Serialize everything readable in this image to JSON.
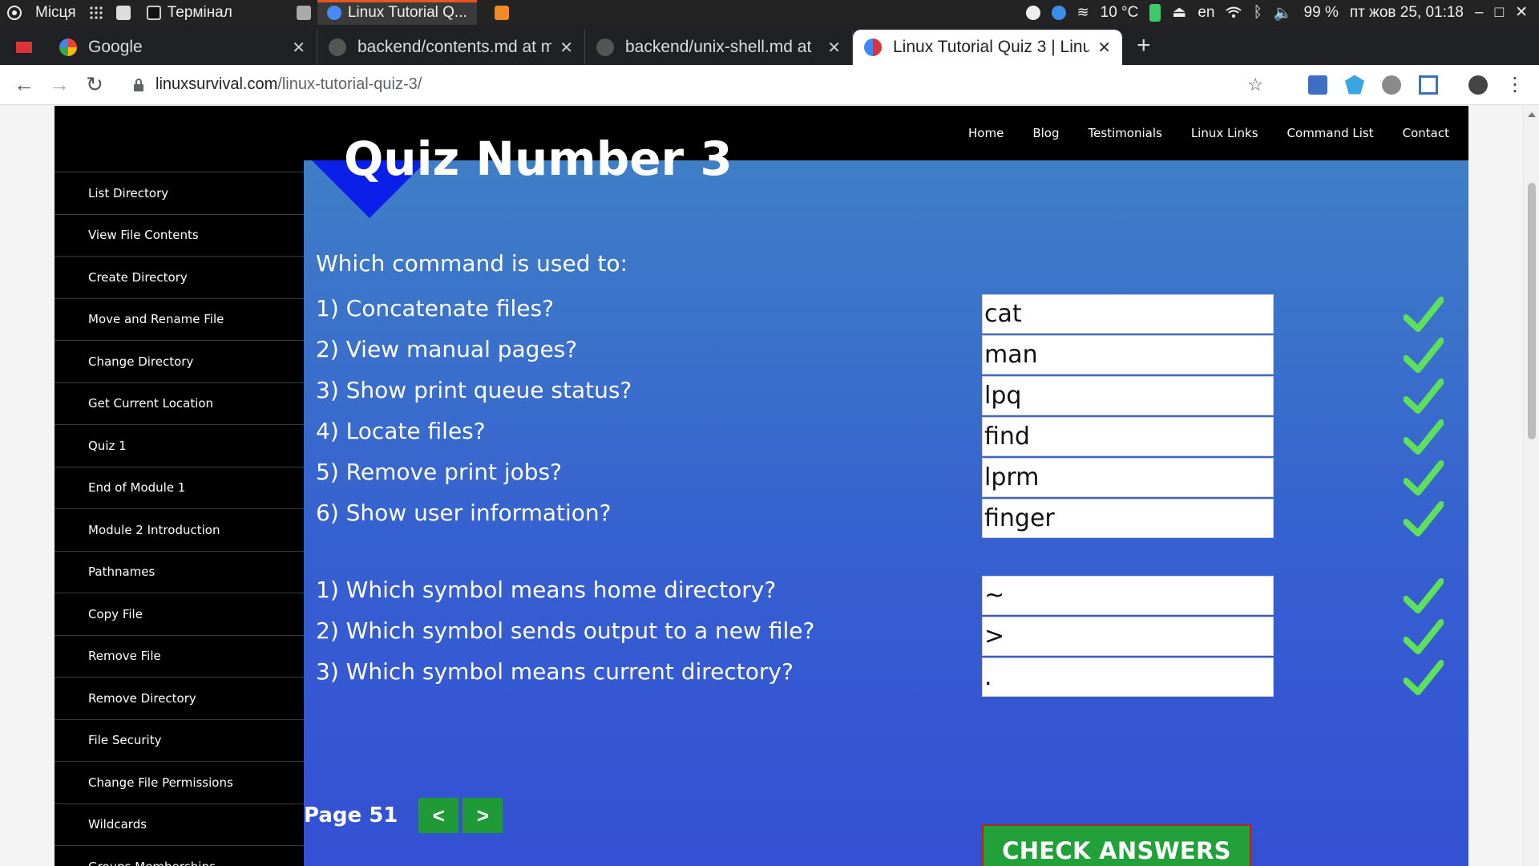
{
  "os_bar": {
    "places_label": "Місця",
    "terminal_label": "Термінал",
    "browser_task_label": "Linux Tutorial Q...",
    "temperature": "10 °C",
    "keyboard_layout": "en",
    "battery": "99 %",
    "datetime": "пт жов 25, 01:18"
  },
  "tabs": [
    {
      "title": "Google",
      "icon": "google-icon"
    },
    {
      "title": "backend/contents.md at m",
      "icon": "github-icon"
    },
    {
      "title": "backend/unix-shell.md at",
      "icon": "github-icon"
    },
    {
      "title": "Linux Tutorial Quiz 3 | Linu",
      "icon": "linuxsurvival-icon"
    }
  ],
  "address_bar": {
    "domain": "linuxsurvival.com",
    "path": "/linux-tutorial-quiz-3/"
  },
  "site_nav": [
    "Home",
    "Blog",
    "Testimonials",
    "Linux Links",
    "Command List",
    "Contact"
  ],
  "sidebar": [
    "List Directory",
    "View File Contents",
    "Create Directory",
    "Move and Rename File",
    "Change Directory",
    "Get Current Location",
    "Quiz 1",
    "End of Module 1",
    "Module 2 Introduction",
    "Pathnames",
    "Copy File",
    "Remove File",
    "Remove Directory",
    "File Security",
    "Change File Permissions",
    "Wildcards",
    "Groups Memberships"
  ],
  "main": {
    "title": "Quiz Number 3",
    "intro": "Which command is used to:",
    "questions": [
      {
        "q": "1) Concatenate files?",
        "a": "cat"
      },
      {
        "q": "2) View manual pages?",
        "a": "man"
      },
      {
        "q": "3) Show print queue status?",
        "a": "lpq"
      },
      {
        "q": "4) Locate files?",
        "a": "find"
      },
      {
        "q": "5) Remove print jobs?",
        "a": "lprm"
      },
      {
        "q": "6) Show user information?",
        "a": "finger"
      },
      {
        "q": "1) Which symbol means home directory?",
        "a": "~"
      },
      {
        "q": "2) Which symbol sends output to a new file?",
        "a": ">"
      },
      {
        "q": "3) Which symbol means current directory?",
        "a": "."
      }
    ],
    "check_button": "CHECK ANSWERS",
    "page_label": "Page 51",
    "prev_label": "<",
    "next_label": ">"
  },
  "colors": {
    "check_green": "#5ee05a",
    "button_green": "#22a13a",
    "nav_black": "#000000",
    "accent_orange": "#e95420"
  }
}
